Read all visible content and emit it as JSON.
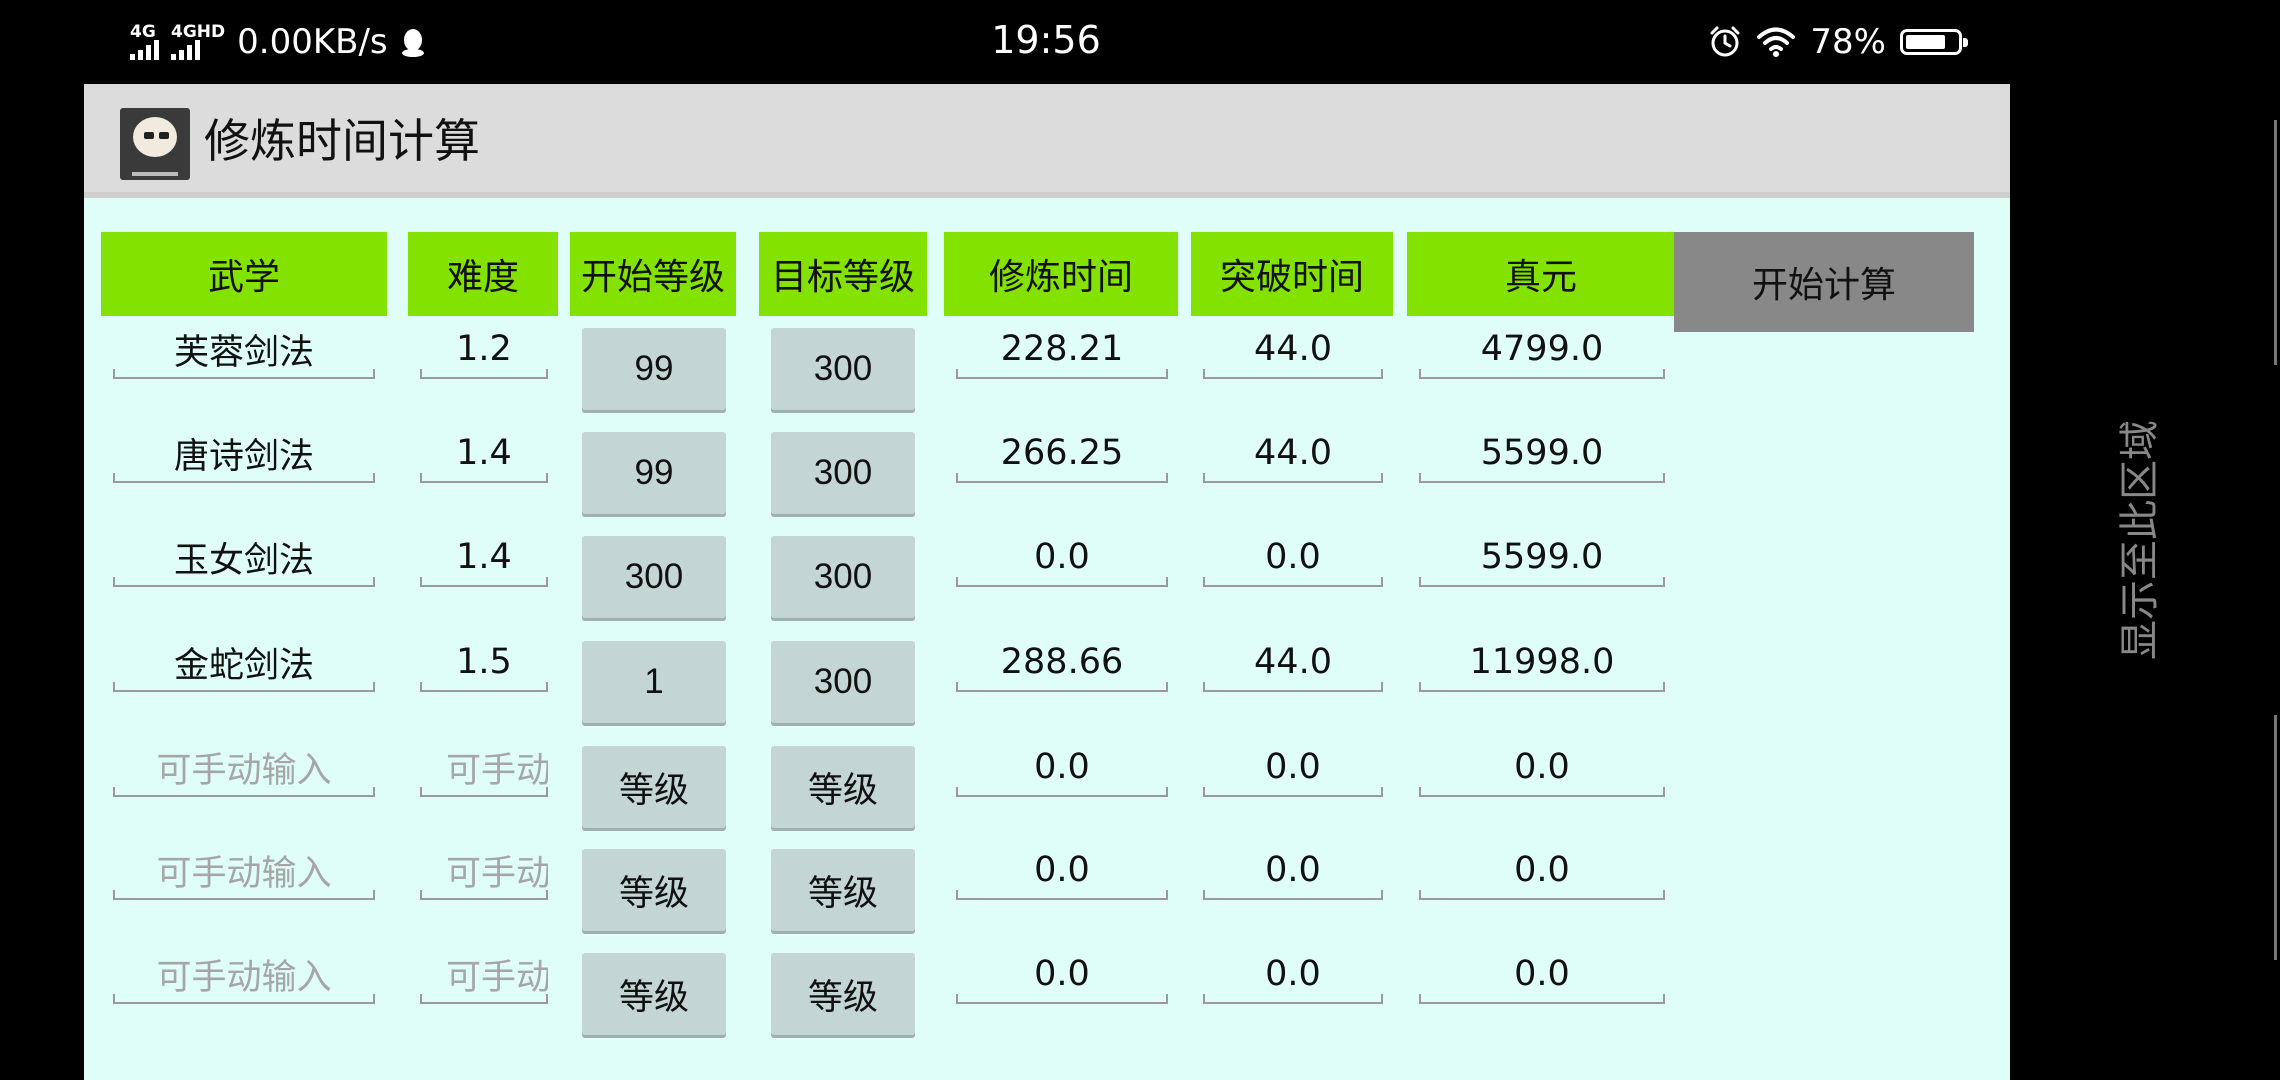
{
  "status_bar": {
    "network1": "4G",
    "network2": "4GHD",
    "speed": "0.00KB/s",
    "time": "19:56",
    "battery": "78%",
    "battery_level": 0.78,
    "icons": [
      "qq-icon",
      "alarm-icon",
      "wifi-icon",
      "battery-icon"
    ]
  },
  "app": {
    "title": "修炼时间计算",
    "headers": [
      "武学",
      "难度",
      "开始等级",
      "目标等级",
      "修炼时间",
      "突破时间",
      "真元"
    ],
    "calc_button": "开始计算",
    "rows": [
      {
        "name": "芙蓉剑法",
        "difficulty": "1.2",
        "start": "99",
        "target": "300",
        "train_time": "228.21",
        "break_time": "44.0",
        "zhenyuan": "4799.0"
      },
      {
        "name": "唐诗剑法",
        "difficulty": "1.4",
        "start": "99",
        "target": "300",
        "train_time": "266.25",
        "break_time": "44.0",
        "zhenyuan": "5599.0"
      },
      {
        "name": "玉女剑法",
        "difficulty": "1.4",
        "start": "300",
        "target": "300",
        "train_time": "0.0",
        "break_time": "0.0",
        "zhenyuan": "5599.0"
      },
      {
        "name": "金蛇剑法",
        "difficulty": "1.5",
        "start": "1",
        "target": "300",
        "train_time": "288.66",
        "break_time": "44.0",
        "zhenyuan": "11998.0"
      },
      {
        "name": "",
        "name_placeholder": "可手动输入",
        "difficulty": "",
        "difficulty_placeholder": "可手动输入",
        "start": "等级",
        "target": "等级",
        "train_time": "0.0",
        "break_time": "0.0",
        "zhenyuan": "0.0"
      },
      {
        "name": "",
        "name_placeholder": "可手动输入",
        "difficulty": "",
        "difficulty_placeholder": "可手动输入",
        "start": "等级",
        "target": "等级",
        "train_time": "0.0",
        "break_time": "0.0",
        "zhenyuan": "0.0"
      },
      {
        "name": "",
        "name_placeholder": "可手动输入",
        "difficulty": "",
        "difficulty_placeholder": "可手动输入",
        "start": "等级",
        "target": "等级",
        "train_time": "0.0",
        "break_time": "0.0",
        "zhenyuan": "0.0"
      }
    ]
  },
  "side_text": "显示至此区域"
}
